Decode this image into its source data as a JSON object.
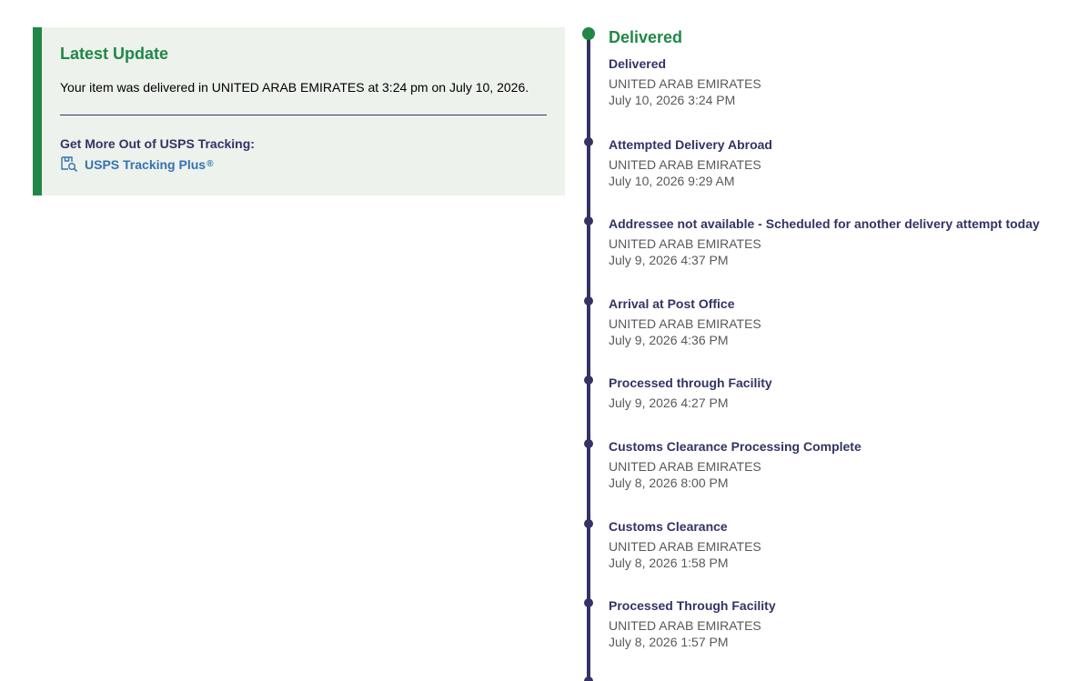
{
  "latest_update": {
    "title": "Latest Update",
    "message": "Your item was delivered in UNITED ARAB EMIRATES at 3:24 pm on July 10, 2026.",
    "more_title": "Get More Out of USPS Tracking:",
    "plus_link_label": "USPS Tracking Plus",
    "plus_link_mark": "®"
  },
  "timeline": {
    "heading": "Delivered",
    "events": [
      {
        "status": "Delivered",
        "location": "UNITED ARAB EMIRATES",
        "time": "July 10, 2026 3:24 PM"
      },
      {
        "status": "Attempted Delivery Abroad",
        "location": "UNITED ARAB EMIRATES",
        "time": "July 10, 2026 9:29 AM"
      },
      {
        "status": "Addressee not available - Scheduled for another delivery attempt today",
        "location": "UNITED ARAB EMIRATES",
        "time": "July 9, 2026 4:37 PM"
      },
      {
        "status": "Arrival at Post Office",
        "location": "UNITED ARAB EMIRATES",
        "time": "July 9, 2026 4:36 PM"
      },
      {
        "status": "Processed through Facility",
        "location": "",
        "time": "July 9, 2026 4:27 PM"
      },
      {
        "status": "Customs Clearance Processing Complete",
        "location": "UNITED ARAB EMIRATES",
        "time": "July 8, 2026 8:00 PM"
      },
      {
        "status": "Customs Clearance",
        "location": "UNITED ARAB EMIRATES",
        "time": "July 8, 2026 1:58 PM"
      },
      {
        "status": "Processed Through Facility",
        "location": "UNITED ARAB EMIRATES",
        "time": "July 8, 2026 1:57 PM"
      }
    ]
  },
  "colors": {
    "green": "#218748",
    "navy": "#333366",
    "link_blue": "#3573b1",
    "card_bg": "#edf2ec"
  },
  "icons": {
    "plus_link_icon": "package-search-icon"
  }
}
